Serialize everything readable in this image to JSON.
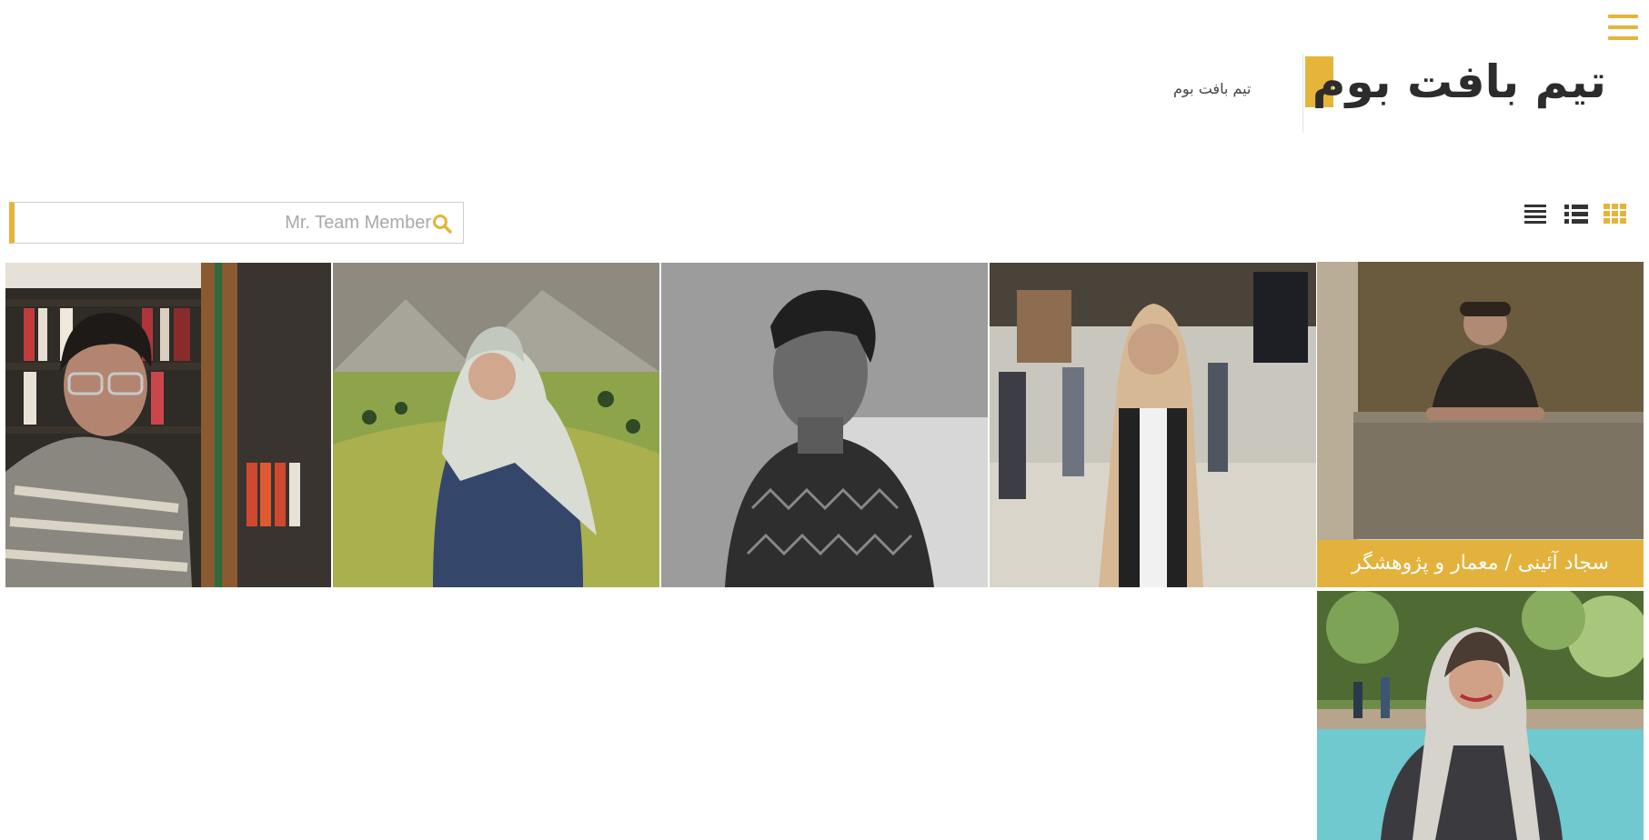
{
  "header": {
    "title": "تیم بافت بوم",
    "subtitle": "تیم بافت بوم",
    "menu_icon": "hamburger-menu-icon",
    "accent_color": "#e6b43a"
  },
  "toolbar": {
    "view_grid_icon": "grid-view-icon",
    "view_list_icon": "list-view-icon",
    "view_compact_icon": "compact-list-view-icon",
    "active_view": "grid"
  },
  "search": {
    "placeholder": "Mr. Team Member",
    "value": "",
    "icon": "search-icon"
  },
  "team": {
    "members": [
      {
        "caption": "سجاد آئینی / معمار و پژوهشگر",
        "photo": "man-behind-concrete-railing"
      },
      {
        "caption": "",
        "photo": "woman-in-hijab-at-station"
      },
      {
        "caption": "",
        "photo": "man-black-and-white-portrait"
      },
      {
        "caption": "",
        "photo": "woman-in-hijab-with-landscape"
      },
      {
        "caption": "",
        "photo": "man-with-glasses-at-bookshelf"
      },
      {
        "caption": "",
        "photo": "woman-in-scarf-by-fountain"
      }
    ]
  }
}
